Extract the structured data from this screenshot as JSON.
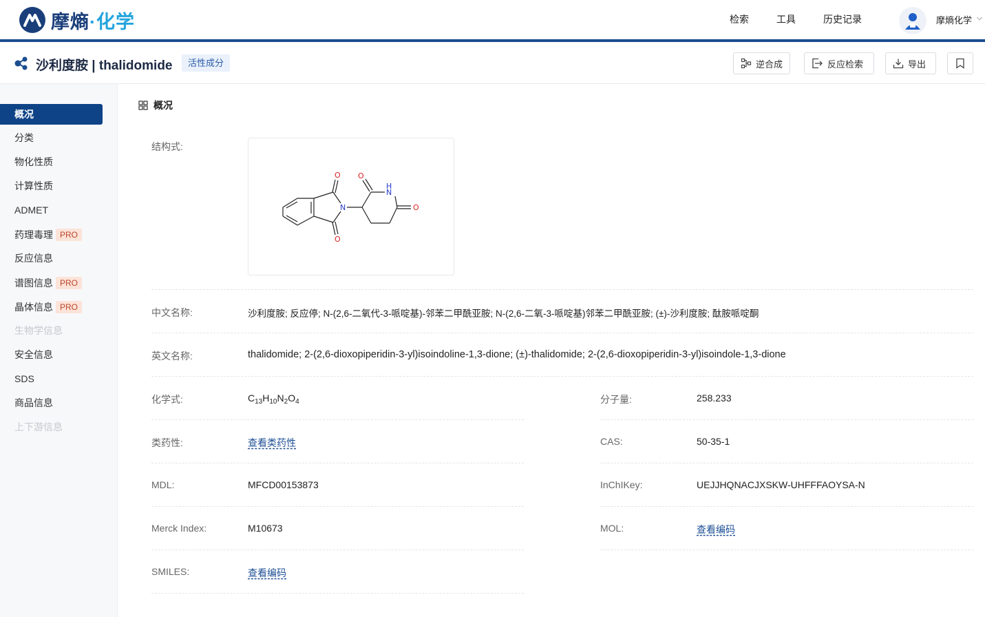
{
  "header": {
    "logo_text_a": "摩熵",
    "logo_text_b": "·化学",
    "nav": [
      "检索",
      "工具",
      "历史记录"
    ],
    "user_name": "摩熵化学",
    "brand_color": "#1b4d8f"
  },
  "titlebar": {
    "title": "沙利度胺 | thalidomide",
    "tag": "活性成分",
    "buttons": {
      "retro": "逆合成",
      "reaction": "反应检索",
      "export": "导出"
    }
  },
  "sidebar": {
    "items": [
      {
        "label": "概况",
        "state": "active"
      },
      {
        "label": "分类"
      },
      {
        "label": "物化性质"
      },
      {
        "label": "计算性质"
      },
      {
        "label": "ADMET"
      },
      {
        "label": "药理毒理",
        "badge": "PRO"
      },
      {
        "label": "反应信息"
      },
      {
        "label": "谱图信息",
        "badge": "PRO"
      },
      {
        "label": "晶体信息",
        "badge": "PRO"
      },
      {
        "label": "生物学信息",
        "state": "disabled"
      },
      {
        "label": "安全信息"
      },
      {
        "label": "SDS"
      },
      {
        "label": "商品信息"
      },
      {
        "label": "上下游信息",
        "state": "disabled"
      }
    ]
  },
  "overview": {
    "heading": "概况",
    "structure_label": "结构式:",
    "structure_atoms": {
      "o": "O",
      "n": "N",
      "h": "H"
    },
    "cn_name_label": "中文名称:",
    "cn_name": "沙利度胺; 反应停; N-(2,6-二氧代-3-哌啶基)-邻苯二甲酰亚胺; N-(2,6-二氧-3-哌啶基)邻苯二甲酰亚胺; (±)-沙利度胺; 酞胺哌啶酮",
    "en_name_label": "英文名称:",
    "en_name": "thalidomide; 2-(2,6-dioxopiperidin-3-yl)isoindoline-1,3-dione; (±)-thalidomide; 2-(2,6-dioxopiperidin-3-yl)isoindole-1,3-dione",
    "formula_label": "化学式:",
    "formula": {
      "c": "C",
      "c_n": "13",
      "h": "H",
      "h_n": "10",
      "n": "N",
      "n_n": "2",
      "o": "O",
      "o_n": "4"
    },
    "mw_label": "分子量:",
    "mw": "258.233",
    "druglike_label": "类药性:",
    "druglike_link": "查看类药性",
    "cas_label": "CAS:",
    "cas": "50-35-1",
    "mdl_label": "MDL:",
    "mdl": "MFCD00153873",
    "inchikey_label": "InChIKey:",
    "inchikey": "UEJJHQNACJXSKW-UHFFFAOYSA-N",
    "merck_label": "Merck Index:",
    "merck": "M10673",
    "mol_label": "MOL:",
    "mol_link": "查看编码",
    "smiles_label": "SMILES:",
    "smiles_link": "查看编码"
  }
}
